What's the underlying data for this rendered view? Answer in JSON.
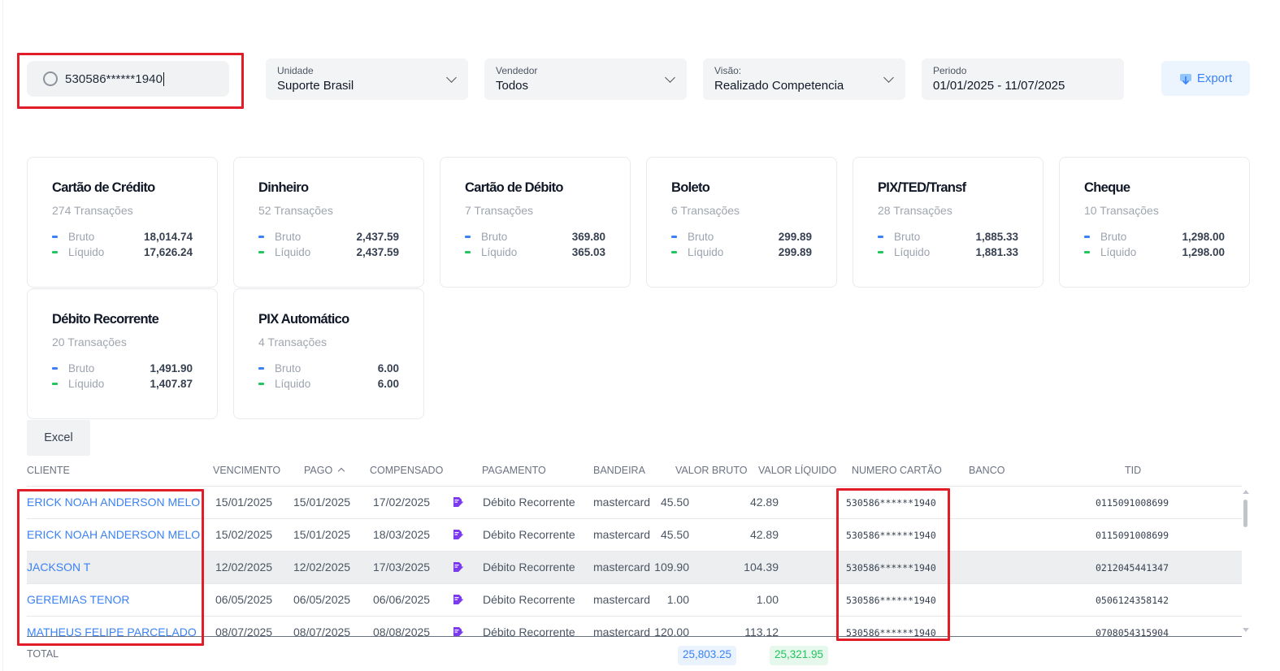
{
  "search": {
    "value": "530586******1940"
  },
  "filters": [
    {
      "label": "Unidade",
      "value": "Suporte Brasil"
    },
    {
      "label": "Vendedor",
      "value": "Todos"
    },
    {
      "label": "Visão:",
      "value": "Realizado Competencia"
    },
    {
      "label": "Periodo",
      "value": "01/01/2025 - 11/07/2025"
    }
  ],
  "export_label": "Export",
  "cards": [
    {
      "title": "Cartão de Crédito",
      "count": "274 Transações",
      "bruto_label": "Bruto",
      "bruto": "18,014.74",
      "liquido_label": "Líquido",
      "liquido": "17,626.24"
    },
    {
      "title": "Dinheiro",
      "count": "52 Transações",
      "bruto_label": "Bruto",
      "bruto": "2,437.59",
      "liquido_label": "Líquido",
      "liquido": "2,437.59"
    },
    {
      "title": "Cartão de Débito",
      "count": "7 Transações",
      "bruto_label": "Bruto",
      "bruto": "369.80",
      "liquido_label": "Líquido",
      "liquido": "365.03"
    },
    {
      "title": "Boleto",
      "count": "6 Transações",
      "bruto_label": "Bruto",
      "bruto": "299.89",
      "liquido_label": "Líquido",
      "liquido": "299.89"
    },
    {
      "title": "PIX/TED/Transf",
      "count": "28 Transações",
      "bruto_label": "Bruto",
      "bruto": "1,885.33",
      "liquido_label": "Líquido",
      "liquido": "1,881.33"
    },
    {
      "title": "Cheque",
      "count": "10 Transações",
      "bruto_label": "Bruto",
      "bruto": "1,298.00",
      "liquido_label": "Líquido",
      "liquido": "1,298.00"
    },
    {
      "title": "Débito Recorrente",
      "count": "20 Transações",
      "bruto_label": "Bruto",
      "bruto": "1,491.90",
      "liquido_label": "Líquido",
      "liquido": "1,407.87"
    },
    {
      "title": "PIX Automático",
      "count": "4 Transações",
      "bruto_label": "Bruto",
      "bruto": "6.00",
      "liquido_label": "Líquido",
      "liquido": "6.00"
    }
  ],
  "excel_label": "Excel",
  "table": {
    "columns": [
      "CLIENTE",
      "VENCIMENTO",
      "PAGO",
      "COMPENSADO",
      "PAGAMENTO",
      "BANDEIRA",
      "VALOR BRUTO",
      "VALOR LÍQUIDO",
      "NUMERO CARTÃO",
      "BANCO",
      "TID"
    ],
    "sorted_column": "PAGO",
    "sort_direction": "ascending",
    "rows": [
      {
        "cliente": "ERICK NOAH ANDERSON MELO",
        "vencimento": "15/01/2025",
        "pago": "15/01/2025",
        "compensado": "17/02/2025",
        "pagamento": "Débito Recorrente",
        "bandeira": "mastercard",
        "bruto": "45.50",
        "liquido": "42.89",
        "cartao": "530586******1940",
        "banco": "",
        "tid": "0115091008699"
      },
      {
        "cliente": "ERICK NOAH ANDERSON MELO",
        "vencimento": "15/02/2025",
        "pago": "15/01/2025",
        "compensado": "18/03/2025",
        "pagamento": "Débito Recorrente",
        "bandeira": "mastercard",
        "bruto": "45.50",
        "liquido": "42.89",
        "cartao": "530586******1940",
        "banco": "",
        "tid": "0115091008699"
      },
      {
        "cliente": "JACKSON T",
        "vencimento": "12/02/2025",
        "pago": "12/02/2025",
        "compensado": "17/03/2025",
        "pagamento": "Débito Recorrente",
        "bandeira": "mastercard",
        "bruto": "109.90",
        "liquido": "104.39",
        "cartao": "530586******1940",
        "banco": "",
        "tid": "0212045441347"
      },
      {
        "cliente": "GEREMIAS TENOR",
        "vencimento": "06/05/2025",
        "pago": "06/05/2025",
        "compensado": "06/06/2025",
        "pagamento": "Débito Recorrente",
        "bandeira": "mastercard",
        "bruto": "1.00",
        "liquido": "1.00",
        "cartao": "530586******1940",
        "banco": "",
        "tid": "0506124358142"
      },
      {
        "cliente": "MATHEUS FELIPE PARCELADO",
        "vencimento": "08/07/2025",
        "pago": "08/07/2025",
        "compensado": "08/08/2025",
        "pagamento": "Débito Recorrente",
        "bandeira": "mastercard",
        "bruto": "120.00",
        "liquido": "113.12",
        "cartao": "530586******1940",
        "banco": "",
        "tid": "0708054315904"
      }
    ],
    "total_label": "TOTAL",
    "total_bruto": "25,803.25",
    "total_liquido": "25,321.95"
  },
  "colors": {
    "accent": "#3b82f6",
    "positive": "#22c55e",
    "highlight_box": "#e11d2a",
    "payment_icon": "#7c3aed"
  },
  "icons": {
    "search": "search-icon",
    "dropdown": "chevron-down-icon",
    "export": "download-icon",
    "payment": "edit-card-icon",
    "sort": "sort-asc-icon"
  }
}
